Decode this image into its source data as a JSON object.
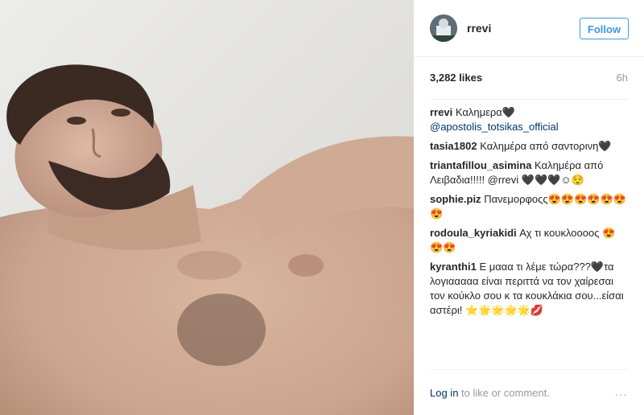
{
  "post": {
    "username": "rrevi",
    "follow_label": "Follow",
    "likes": "3,282 likes",
    "time": "6h"
  },
  "comments": [
    {
      "user": "rrevi",
      "text": "Καλημερα🖤",
      "mention": "@apostolis_totsikas_official"
    },
    {
      "user": "tasia1802",
      "text": "Καλημέρα από σαντορινη🖤"
    },
    {
      "user": "triantafillou_asimina",
      "text": "Καλημέρα από Λειβαδια!!!!! @rrevi 🖤🖤🖤☺😌"
    },
    {
      "user": "sophie.piz",
      "text": "Πανεμορφοςς😍😍😍😍😍😍😍"
    },
    {
      "user": "rodoula_kyriakidi",
      "text": "Αχ τι κουκλοοοος 😍😍😍"
    },
    {
      "user": "kyranthi1",
      "text": "Ε μααα τι λέμε τώρα???🖤τα λογιααααα είναι περιττά να τον χαίρεσαι τον κούκλο σου κ τα κουκλάκια σου...είσαι αστέρι! ⭐🌟🌟🌟🌟💋"
    }
  ],
  "footer": {
    "login_link": "Log in",
    "login_text": " to like or comment.",
    "more_icon": "..."
  }
}
